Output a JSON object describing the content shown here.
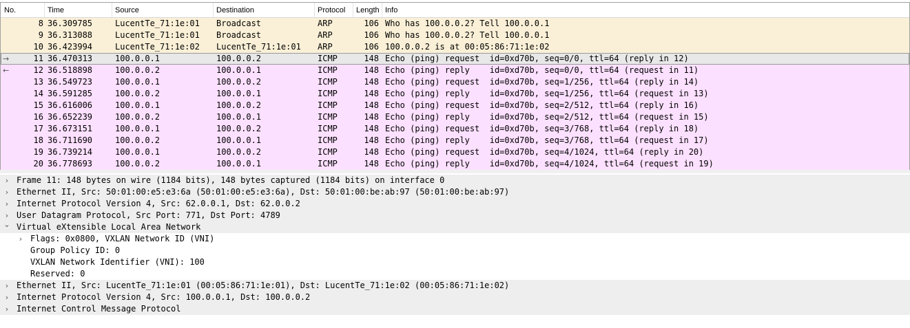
{
  "columns": {
    "no": "No.",
    "time": "Time",
    "source": "Source",
    "destination": "Destination",
    "protocol": "Protocol",
    "length": "Length",
    "info": "Info"
  },
  "packets": [
    {
      "no": "8",
      "time": "36.309785",
      "src": "LucentTe_71:1e:01",
      "dst": "Broadcast",
      "proto": "ARP",
      "len": "106",
      "info": "Who has 100.0.0.2? Tell 100.0.0.1",
      "rel": ""
    },
    {
      "no": "9",
      "time": "36.313088",
      "src": "LucentTe_71:1e:01",
      "dst": "Broadcast",
      "proto": "ARP",
      "len": "106",
      "info": "Who has 100.0.0.2? Tell 100.0.0.1",
      "rel": ""
    },
    {
      "no": "10",
      "time": "36.423994",
      "src": "LucentTe_71:1e:02",
      "dst": "LucentTe_71:1e:01",
      "proto": "ARP",
      "len": "106",
      "info": "100.0.0.2 is at 00:05:86:71:1e:02",
      "rel": ""
    },
    {
      "no": "11",
      "time": "36.470313",
      "src": "100.0.0.1",
      "dst": "100.0.0.2",
      "proto": "ICMP",
      "len": "148",
      "info": "Echo (ping) request  id=0xd70b, seq=0/0, ttl=64 (reply in 12)",
      "rel": "→"
    },
    {
      "no": "12",
      "time": "36.518898",
      "src": "100.0.0.2",
      "dst": "100.0.0.1",
      "proto": "ICMP",
      "len": "148",
      "info": "Echo (ping) reply    id=0xd70b, seq=0/0, ttl=64 (request in 11)",
      "rel": "←"
    },
    {
      "no": "13",
      "time": "36.549723",
      "src": "100.0.0.1",
      "dst": "100.0.0.2",
      "proto": "ICMP",
      "len": "148",
      "info": "Echo (ping) request  id=0xd70b, seq=1/256, ttl=64 (reply in 14)",
      "rel": ""
    },
    {
      "no": "14",
      "time": "36.591285",
      "src": "100.0.0.2",
      "dst": "100.0.0.1",
      "proto": "ICMP",
      "len": "148",
      "info": "Echo (ping) reply    id=0xd70b, seq=1/256, ttl=64 (request in 13)",
      "rel": ""
    },
    {
      "no": "15",
      "time": "36.616006",
      "src": "100.0.0.1",
      "dst": "100.0.0.2",
      "proto": "ICMP",
      "len": "148",
      "info": "Echo (ping) request  id=0xd70b, seq=2/512, ttl=64 (reply in 16)",
      "rel": ""
    },
    {
      "no": "16",
      "time": "36.652239",
      "src": "100.0.0.2",
      "dst": "100.0.0.1",
      "proto": "ICMP",
      "len": "148",
      "info": "Echo (ping) reply    id=0xd70b, seq=2/512, ttl=64 (request in 15)",
      "rel": ""
    },
    {
      "no": "17",
      "time": "36.673151",
      "src": "100.0.0.1",
      "dst": "100.0.0.2",
      "proto": "ICMP",
      "len": "148",
      "info": "Echo (ping) request  id=0xd70b, seq=3/768, ttl=64 (reply in 18)",
      "rel": ""
    },
    {
      "no": "18",
      "time": "36.711690",
      "src": "100.0.0.2",
      "dst": "100.0.0.1",
      "proto": "ICMP",
      "len": "148",
      "info": "Echo (ping) reply    id=0xd70b, seq=3/768, ttl=64 (request in 17)",
      "rel": ""
    },
    {
      "no": "19",
      "time": "36.739214",
      "src": "100.0.0.1",
      "dst": "100.0.0.2",
      "proto": "ICMP",
      "len": "148",
      "info": "Echo (ping) request  id=0xd70b, seq=4/1024, ttl=64 (reply in 20)",
      "rel": ""
    },
    {
      "no": "20",
      "time": "36.778693",
      "src": "100.0.0.2",
      "dst": "100.0.0.1",
      "proto": "ICMP",
      "len": "148",
      "info": "Echo (ping) reply    id=0xd70b, seq=4/1024, ttl=64 (request in 19)",
      "rel": ""
    }
  ],
  "details": [
    {
      "text": "Frame 11: 148 bytes on wire (1184 bits), 148 bytes captured (1184 bits) on interface 0",
      "state": "collapsed",
      "level": 0
    },
    {
      "text": "Ethernet II, Src: 50:01:00:e5:e3:6a (50:01:00:e5:e3:6a), Dst: 50:01:00:be:ab:97 (50:01:00:be:ab:97)",
      "state": "collapsed",
      "level": 0
    },
    {
      "text": "Internet Protocol Version 4, Src: 62.0.0.1, Dst: 62.0.0.2",
      "state": "collapsed",
      "level": 0
    },
    {
      "text": "User Datagram Protocol, Src Port: 771, Dst Port: 4789",
      "state": "collapsed",
      "level": 0
    },
    {
      "text": "Virtual eXtensible Local Area Network",
      "state": "expanded",
      "level": 0
    },
    {
      "text": "Flags: 0x0800, VXLAN Network ID (VNI)",
      "state": "collapsed",
      "level": 1
    },
    {
      "text": "Group Policy ID: 0",
      "state": "leaf",
      "level": 1
    },
    {
      "text": "VXLAN Network Identifier (VNI): 100",
      "state": "leaf",
      "level": 1
    },
    {
      "text": "Reserved: 0",
      "state": "leaf",
      "level": 1
    },
    {
      "text": "Ethernet II, Src: LucentTe_71:1e:01 (00:05:86:71:1e:01), Dst: LucentTe_71:1e:02 (00:05:86:71:1e:02)",
      "state": "collapsed",
      "level": 0
    },
    {
      "text": "Internet Protocol Version 4, Src: 100.0.0.1, Dst: 100.0.0.2",
      "state": "collapsed",
      "level": 0
    },
    {
      "text": "Internet Control Message Protocol",
      "state": "collapsed",
      "level": 0
    }
  ],
  "icons": {
    "collapsed": "chevron-right-icon",
    "expanded": "chevron-down-icon",
    "request": "arrow-right-icon",
    "reply": "arrow-left-icon"
  },
  "colors": {
    "arp_row": "#faf0d7",
    "icmp_row": "#fce0ff",
    "selected_row": "#e8e8e8"
  }
}
